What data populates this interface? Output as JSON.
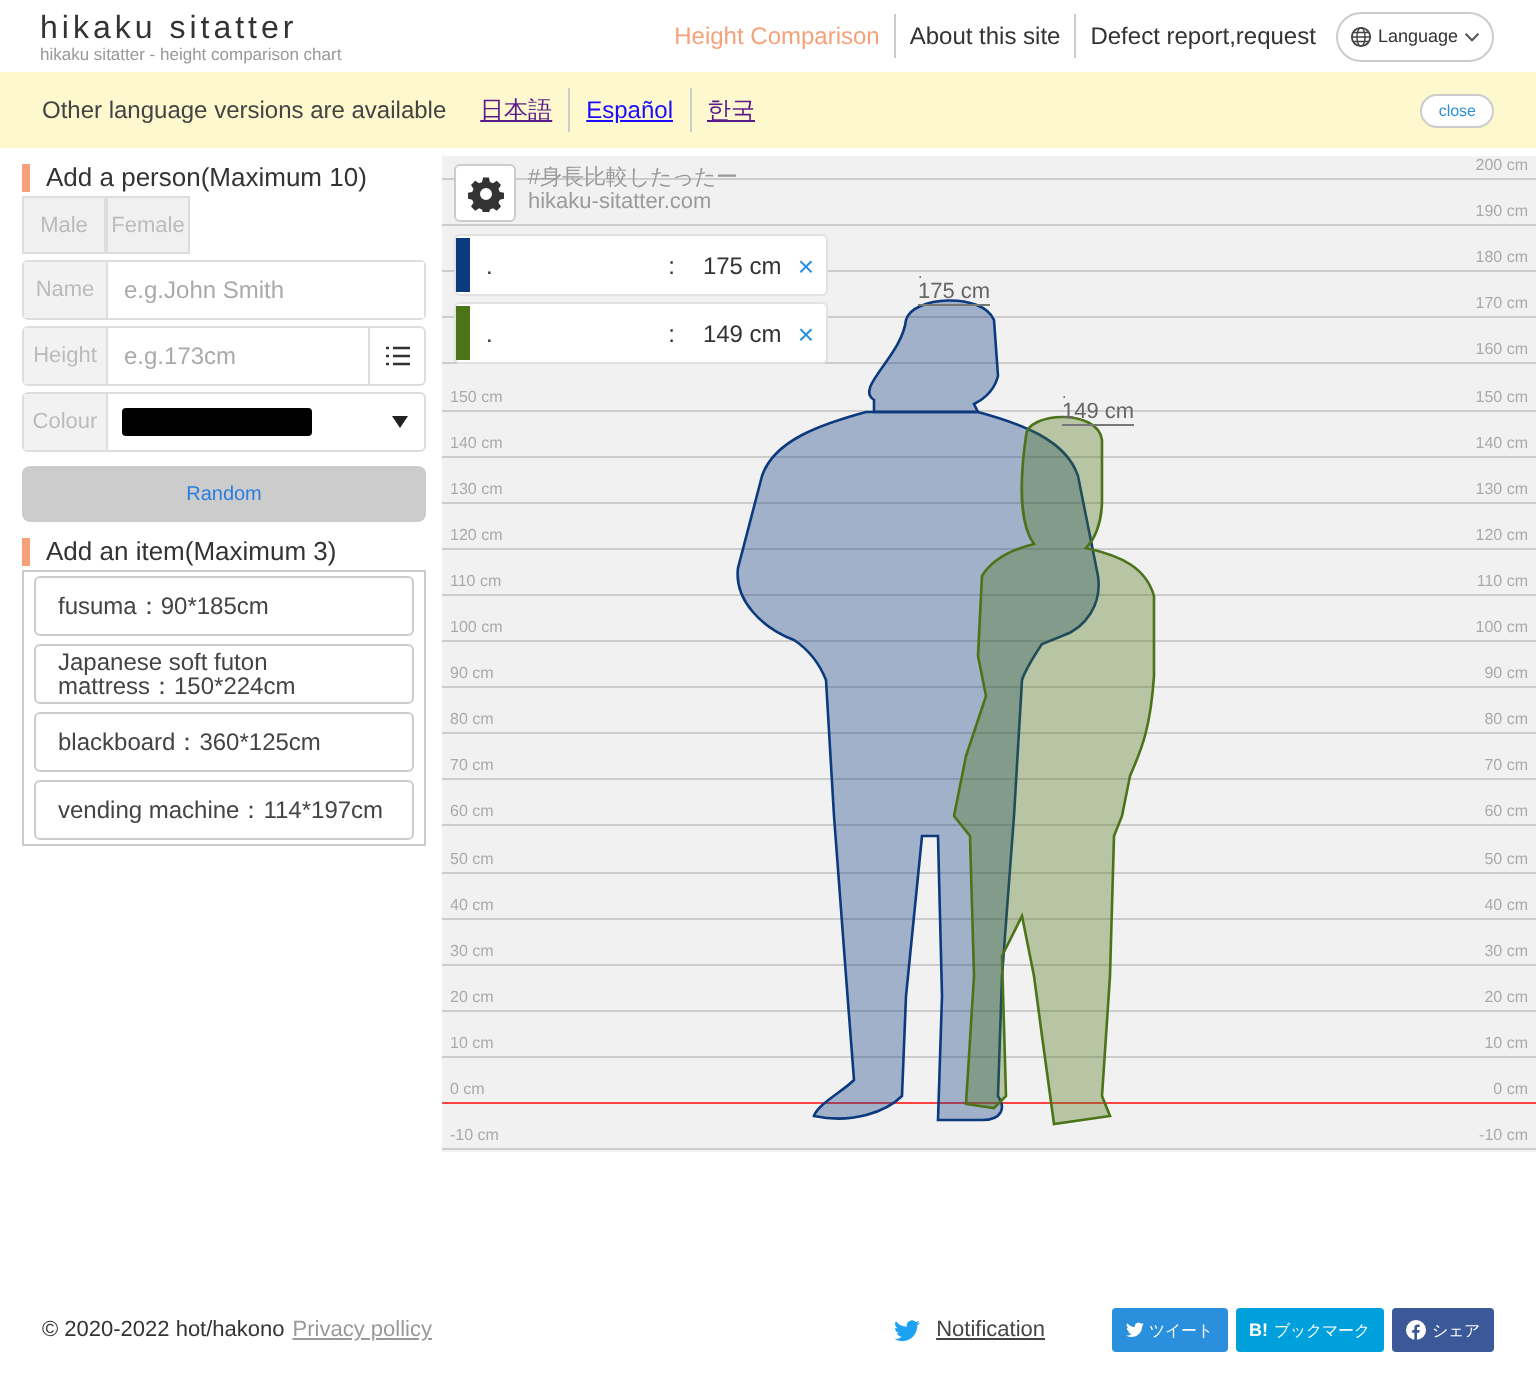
{
  "header": {
    "logo": "hikaku sitatter",
    "tagline": "hikaku sitatter - height comparison chart",
    "nav": [
      {
        "label": "Height Comparison",
        "selected": true
      },
      {
        "label": "About this site",
        "selected": false
      },
      {
        "label": "Defect report,request",
        "selected": false
      }
    ],
    "language_button": "Language"
  },
  "banner": {
    "text": "Other language versions are available",
    "links": [
      {
        "label": "日本語",
        "visited": true
      },
      {
        "label": "Español",
        "visited": false
      },
      {
        "label": "한국",
        "visited": true
      }
    ],
    "close": "close"
  },
  "add_person": {
    "heading": "Add a person(Maximum 10)",
    "genders": [
      {
        "label": "Male",
        "selected": false
      },
      {
        "label": "Female",
        "selected": false
      }
    ],
    "name_label": "Name",
    "name_placeholder": "e.g.John Smith",
    "height_label": "Height",
    "height_placeholder": "e.g.173cm",
    "colour_label": "Colour",
    "random": "Random"
  },
  "add_item": {
    "heading": "Add an item(Maximum 3)",
    "items": [
      "fusuma：90*185cm",
      "Japanese soft futon mattress：150*224cm",
      "blackboard：360*125cm",
      "vending machine：114*197cm"
    ]
  },
  "chart": {
    "watermark": [
      "#身長比較したったー",
      "hikaku-sitatter.com"
    ],
    "people": [
      {
        "name": ".",
        "separator": ":",
        "height": "175 cm",
        "color": "#0b3a7e",
        "remove": "×",
        "figure_name": ".",
        "figure_height": "175 cm"
      },
      {
        "name": ".",
        "separator": ":",
        "height": "149 cm",
        "color": "#4b7318",
        "remove": "×",
        "figure_name": ".",
        "figure_height": "149 cm"
      }
    ],
    "scale": [
      {
        "right": "200 cm",
        "baseline": false
      },
      {
        "right": "190 cm",
        "baseline": false
      },
      {
        "right": "180 cm",
        "baseline": false
      },
      {
        "right": "170 cm",
        "baseline": false
      },
      {
        "right": "160 cm",
        "baseline": false
      },
      {
        "left": "150 cm",
        "right": "150 cm",
        "baseline": false
      },
      {
        "left": "140 cm",
        "right": "140 cm",
        "baseline": false
      },
      {
        "left": "130 cm",
        "right": "130 cm",
        "baseline": false
      },
      {
        "left": "120 cm",
        "right": "120 cm",
        "baseline": false
      },
      {
        "left": "110 cm",
        "right": "110 cm",
        "baseline": false
      },
      {
        "left": "100 cm",
        "right": "100 cm",
        "baseline": false
      },
      {
        "left": "90 cm",
        "right": "90 cm",
        "baseline": false
      },
      {
        "left": "80 cm",
        "right": "80 cm",
        "baseline": false
      },
      {
        "left": "70 cm",
        "right": "70 cm",
        "baseline": false
      },
      {
        "left": "60 cm",
        "right": "60 cm",
        "baseline": false
      },
      {
        "left": "50 cm",
        "right": "50 cm",
        "baseline": false
      },
      {
        "left": "40 cm",
        "right": "40 cm",
        "baseline": false
      },
      {
        "left": "30 cm",
        "right": "30 cm",
        "baseline": false
      },
      {
        "left": "20 cm",
        "right": "20 cm",
        "baseline": false
      },
      {
        "left": "10 cm",
        "right": "10 cm",
        "baseline": false
      },
      {
        "left": "0 cm",
        "right": "0 cm",
        "baseline": true
      },
      {
        "left": "-10 cm",
        "right": "-10 cm",
        "baseline": false
      }
    ]
  },
  "footer": {
    "copyright": "© 2020-2022 hot/hakono",
    "privacy": "Privacy pollicy",
    "notification": "Notification",
    "share": [
      {
        "kind": "twitter",
        "label": "ツイート"
      },
      {
        "kind": "hatena",
        "mark": "B!",
        "label": "ブックマーク"
      },
      {
        "kind": "facebook",
        "label": "シェア"
      }
    ]
  }
}
